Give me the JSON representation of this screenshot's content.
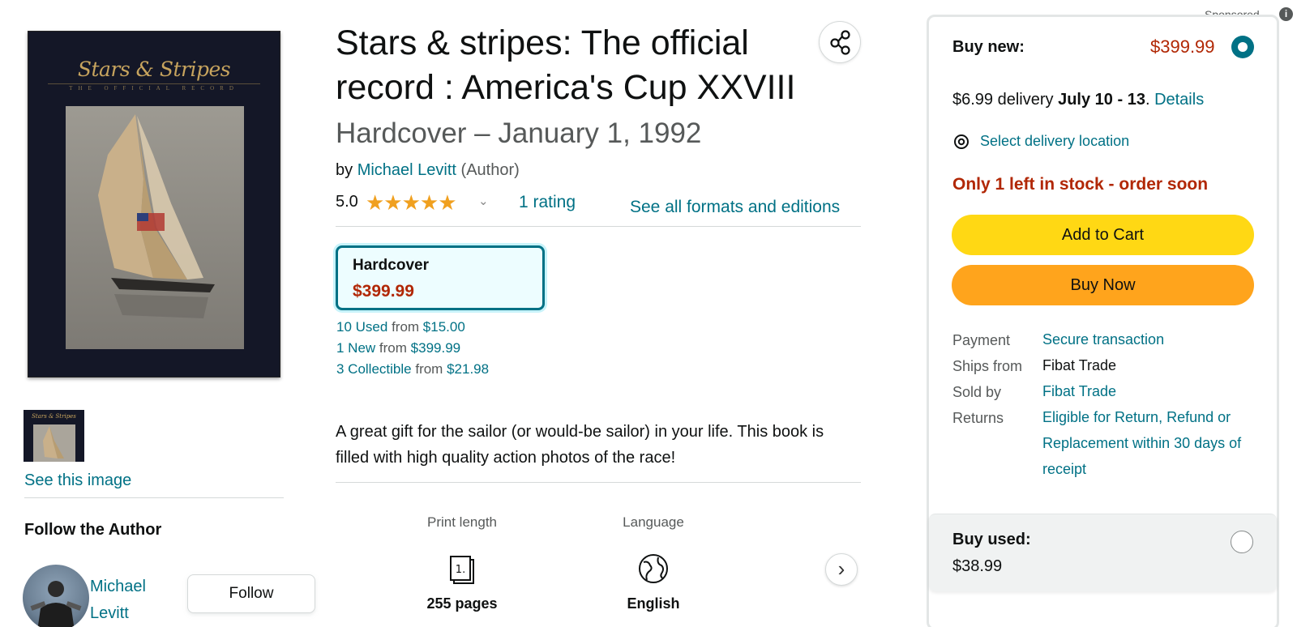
{
  "product": {
    "title": "Stars & stripes: The official record : America's Cup XXVIII",
    "format_date": "Hardcover – January 1, 1992",
    "by_prefix": "by",
    "author": "Michael Levitt",
    "author_role": "(Author)",
    "rating_value": "5.0",
    "stars": "★★★★★",
    "rating_count": "1 rating",
    "formats_link": "See all formats and editions",
    "description": "A great gift for the sailor (or would-be sailor) in your life. This book is filled with high quality action photos of the race!"
  },
  "cover": {
    "script_title": "Stars & Stripes",
    "sub_title": "THE OFFICIAL RECORD"
  },
  "gallery": {
    "see_image": "See this image"
  },
  "follow": {
    "title": "Follow the Author",
    "author_first": "Michael",
    "author_last": "Levitt",
    "button": "Follow"
  },
  "format_selected": {
    "name": "Hardcover",
    "price": "$399.99"
  },
  "offers": [
    {
      "label": "10 Used",
      "from": "from",
      "price": "$15.00"
    },
    {
      "label": "1 New",
      "from": "from",
      "price": "$399.99"
    },
    {
      "label": "3 Collectible",
      "from": "from",
      "price": "$21.98"
    }
  ],
  "attributes": [
    {
      "label": "Print length",
      "icon": "book-pages-icon",
      "value": "255 pages"
    },
    {
      "label": "Language",
      "icon": "globe-icon",
      "value": "English"
    }
  ],
  "buybox": {
    "sponsored": "Sponsored",
    "buy_new_label": "Buy new:",
    "buy_new_price": "$399.99",
    "delivery_prefix": "$6.99 delivery",
    "delivery_dates": "July 10 - 13",
    "details_link": "Details",
    "location_link": "Select delivery location",
    "stock": "Only 1 left in stock - order soon",
    "add_to_cart": "Add to Cart",
    "buy_now": "Buy Now",
    "payment_label": "Payment",
    "payment_value": "Secure transaction",
    "ships_label": "Ships from",
    "ships_value": "Fibat Trade",
    "sold_label": "Sold by",
    "sold_value": "Fibat Trade",
    "returns_label": "Returns",
    "returns_value": "Eligible for Return, Refund or Replacement within 30 days of receipt",
    "buy_used_label": "Buy used:",
    "buy_used_price": "$38.99"
  },
  "colors": {
    "link": "#007185",
    "price": "#b12704",
    "add_to_cart": "#ffd814",
    "buy_now": "#ffa41c",
    "star": "#f0a01f"
  }
}
